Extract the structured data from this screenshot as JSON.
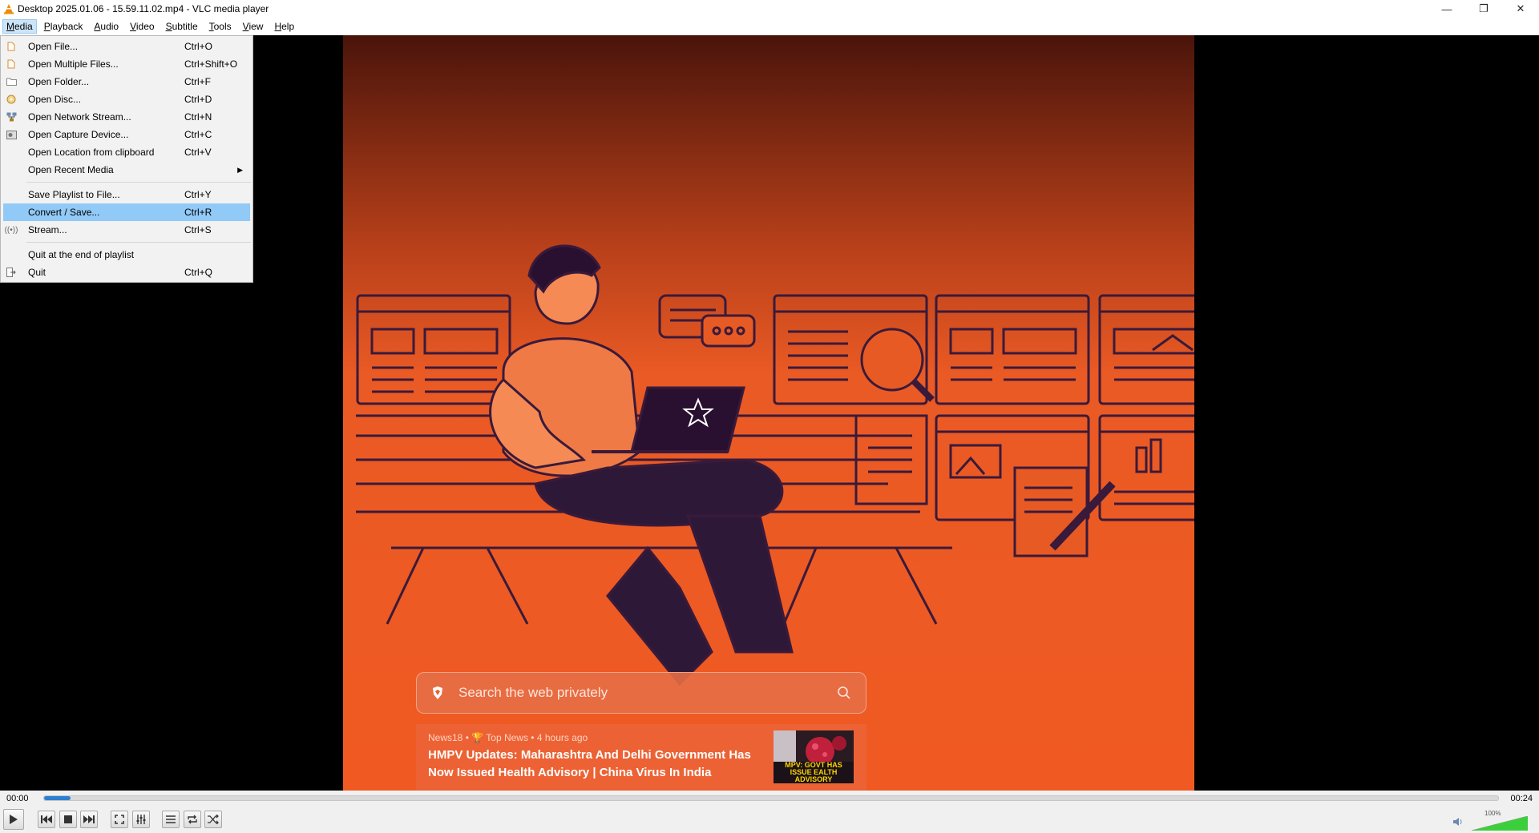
{
  "window": {
    "title": "Desktop 2025.01.06 - 15.59.11.02.mp4 - VLC media player",
    "minimize": "—",
    "maximize": "❐",
    "close": "✕"
  },
  "menubar": {
    "items": [
      {
        "label": "Media",
        "key": "M",
        "rest": "edia",
        "active": true
      },
      {
        "label": "Playback",
        "key": "P",
        "rest": "layback"
      },
      {
        "label": "Audio",
        "key": "A",
        "rest": "udio"
      },
      {
        "label": "Video",
        "key": "V",
        "rest": "ideo"
      },
      {
        "label": "Subtitle",
        "key": "S",
        "rest": "ubtitle"
      },
      {
        "label": "Tools",
        "key": "T",
        "rest": "ools"
      },
      {
        "label": "View",
        "key": "V",
        "rest": "iew"
      },
      {
        "label": "Help",
        "key": "H",
        "rest": "elp"
      }
    ]
  },
  "media_menu": {
    "open_file": {
      "label": "Open File...",
      "shortcut": "Ctrl+O"
    },
    "open_multiple": {
      "label": "Open Multiple Files...",
      "shortcut": "Ctrl+Shift+O"
    },
    "open_folder": {
      "label": "Open Folder...",
      "shortcut": "Ctrl+F"
    },
    "open_disc": {
      "label": "Open Disc...",
      "shortcut": "Ctrl+D"
    },
    "open_network": {
      "label": "Open Network Stream...",
      "shortcut": "Ctrl+N"
    },
    "open_capture": {
      "label": "Open Capture Device...",
      "shortcut": "Ctrl+C"
    },
    "open_clipboard": {
      "label": "Open Location from clipboard",
      "shortcut": "Ctrl+V"
    },
    "open_recent": {
      "label": "Open Recent Media",
      "shortcut": ""
    },
    "save_playlist": {
      "label": "Save Playlist to File...",
      "shortcut": "Ctrl+Y"
    },
    "convert_save": {
      "label": "Convert / Save...",
      "shortcut": "Ctrl+R"
    },
    "stream": {
      "label": "Stream...",
      "shortcut": "Ctrl+S"
    },
    "quit_end": {
      "label": "Quit at the end of playlist",
      "shortcut": ""
    },
    "quit": {
      "label": "Quit",
      "shortcut": "Ctrl+Q"
    }
  },
  "video": {
    "search_placeholder": "Search the web privately",
    "news_meta": "News18 • 🏆 Top News • 4 hours ago",
    "news_title": "HMPV Updates: Maharashtra And Delhi Government Has Now Issued Health Advisory | China Virus In India",
    "thumb_caption": "MPV: GOVT HAS ISSUE EALTH ADVISORY"
  },
  "player": {
    "time_elapsed": "00:00",
    "time_total": "00:24",
    "progress": 0.018,
    "volume_percent": "100%"
  },
  "colors": {
    "selection": "#91c9f7",
    "seek_fill": "#2f7fd0",
    "volume_green": "#3ccf3c",
    "video_orange": "#f05a22"
  }
}
